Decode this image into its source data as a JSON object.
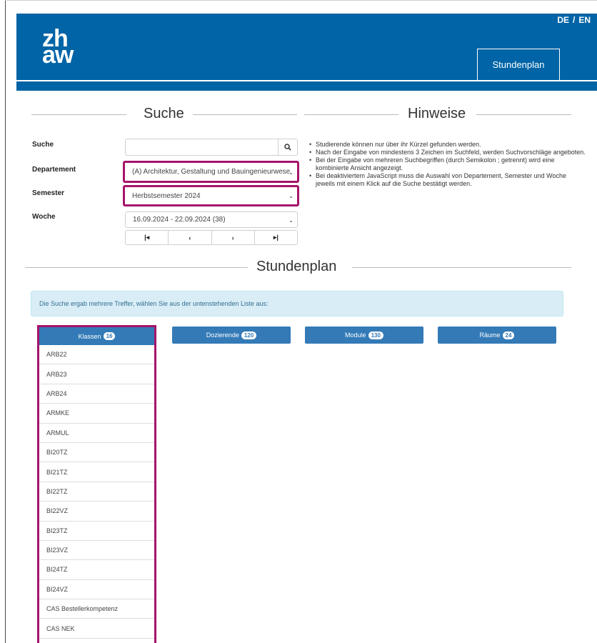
{
  "header": {
    "logo_line1": "zh",
    "logo_line2": "aw",
    "lang_de": "DE",
    "lang_sep": "/",
    "lang_en": "EN",
    "tab": "Stundenplan"
  },
  "search_section": {
    "title": "Suche",
    "labels": {
      "suche": "Suche",
      "departement": "Departement",
      "semester": "Semester",
      "woche": "Woche"
    },
    "search_value": "",
    "departement_value": "(A) Architektur, Gestaltung und Bauingenieurwese",
    "semester_value": "Herbstsemester 2024",
    "woche_value": "16.09.2024 - 22.09.2024 (38)",
    "nav": [
      "⏮",
      "‹",
      "›",
      "⏭"
    ]
  },
  "hints_section": {
    "title": "Hinweise",
    "items": [
      "Studierende können nur über ihr Kürzel gefunden werden.",
      "Nach der Eingabe von mindestens 3 Zeichen im Suchfeld, werden Suchvorschläge angeboten.",
      "Bei der Eingabe von mehreren Suchbegriffen (durch Semikolon ; getrennt) wird eine kombinierte Ansicht angezeigt.",
      "Bei deaktiviertem JavaScript muss die Auswahl von Departement, Semester und Woche jeweils mit einem Klick auf die Suche bestätigt werden."
    ]
  },
  "schedule_section": {
    "title": "Stundenplan",
    "info": "Die Suche ergab mehrere Treffer, wählen Sie aus der untenstehenden Liste aus:",
    "tabs": [
      {
        "label": "Klassen",
        "count": "16"
      },
      {
        "label": "Dozierende",
        "count": "120"
      },
      {
        "label": "Module",
        "count": "130"
      },
      {
        "label": "Räume",
        "count": "24"
      }
    ],
    "classes": [
      "ARB22",
      "ARB23",
      "ARB24",
      "ARMKE",
      "ARMUL",
      "BI20TZ",
      "BI21TZ",
      "BI22TZ",
      "BI22VZ",
      "BI23TZ",
      "BI23VZ",
      "BI24TZ",
      "BI24VZ",
      "CAS Bestellerkompetenz",
      "CAS NEK"
    ]
  },
  "colors": {
    "brand_blue": "#0064a6",
    "button_blue": "#337ab7",
    "highlight": "#a5146a",
    "info_bg": "#d9edf7"
  },
  "icons": {
    "search": "search-icon",
    "dropdown": "chevron-down-icon"
  }
}
